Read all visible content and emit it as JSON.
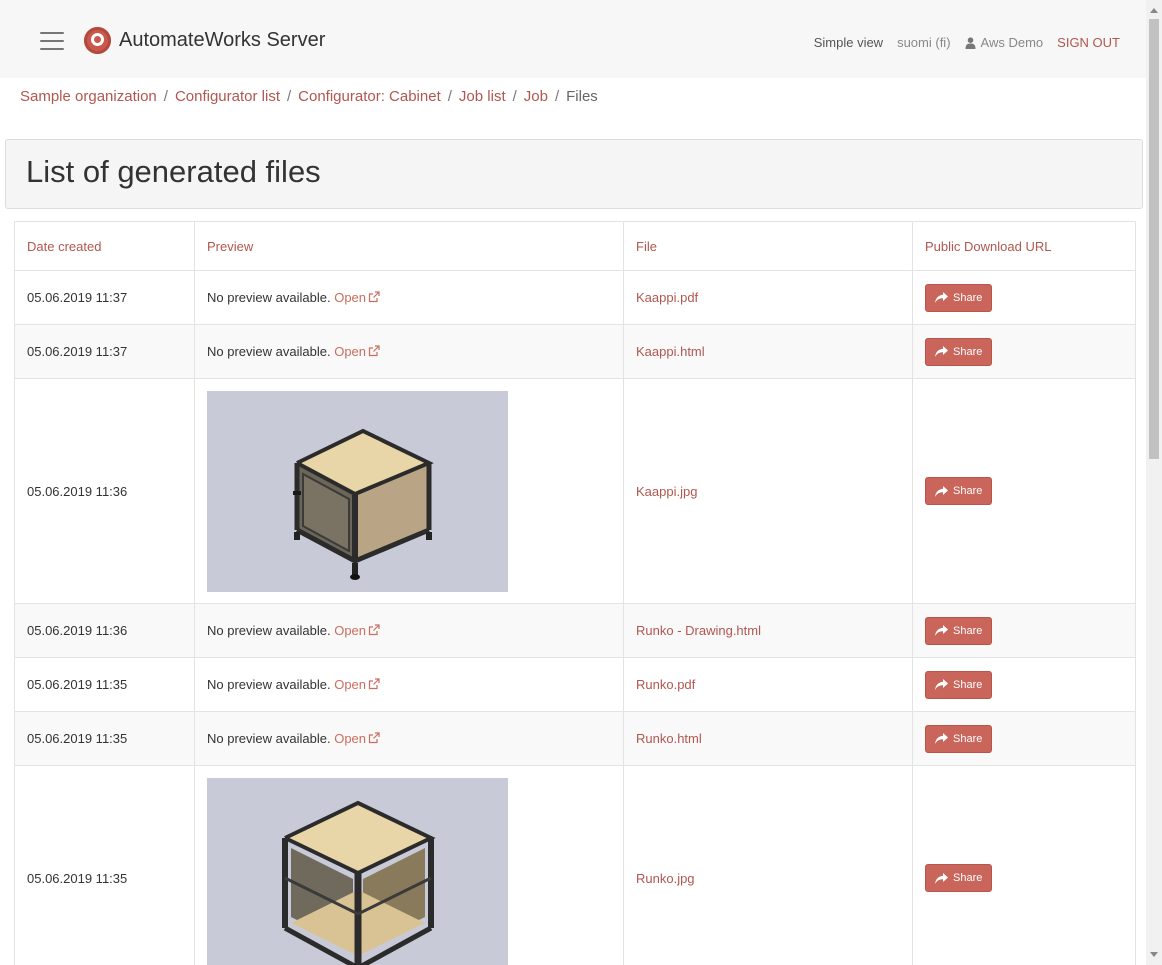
{
  "header": {
    "app_title": "AutomateWorks Server",
    "simple_view": "Simple view",
    "language": "suomi (fi)",
    "user": "Aws Demo",
    "sign_out": "SIGN OUT"
  },
  "breadcrumb": {
    "items": [
      "Sample organization",
      "Configurator list",
      "Configurator: Cabinet",
      "Job list",
      "Job"
    ],
    "current": "Files",
    "separator": "/"
  },
  "page": {
    "title": "List of generated files"
  },
  "table": {
    "columns": [
      "Date created",
      "Preview",
      "File",
      "Public Download URL"
    ],
    "no_preview_text": "No preview available.",
    "open_label": "Open",
    "share_label": "Share",
    "rows": [
      {
        "date": "05.06.2019 11:37",
        "file": "Kaappi.pdf"
      },
      {
        "date": "05.06.2019 11:37",
        "file": "Kaappi.html"
      },
      {
        "date": "05.06.2019 11:36",
        "file": "Kaappi.jpg"
      },
      {
        "date": "05.06.2019 11:36",
        "file": "Runko - Drawing.html"
      },
      {
        "date": "05.06.2019 11:35",
        "file": "Runko.pdf"
      },
      {
        "date": "05.06.2019 11:35",
        "file": "Runko.html"
      },
      {
        "date": "05.06.2019 11:35",
        "file": "Runko.jpg"
      }
    ]
  },
  "colors": {
    "accent": "#b0574f",
    "share_button": "#c9655a",
    "thumb_background": "#c9cad8"
  }
}
